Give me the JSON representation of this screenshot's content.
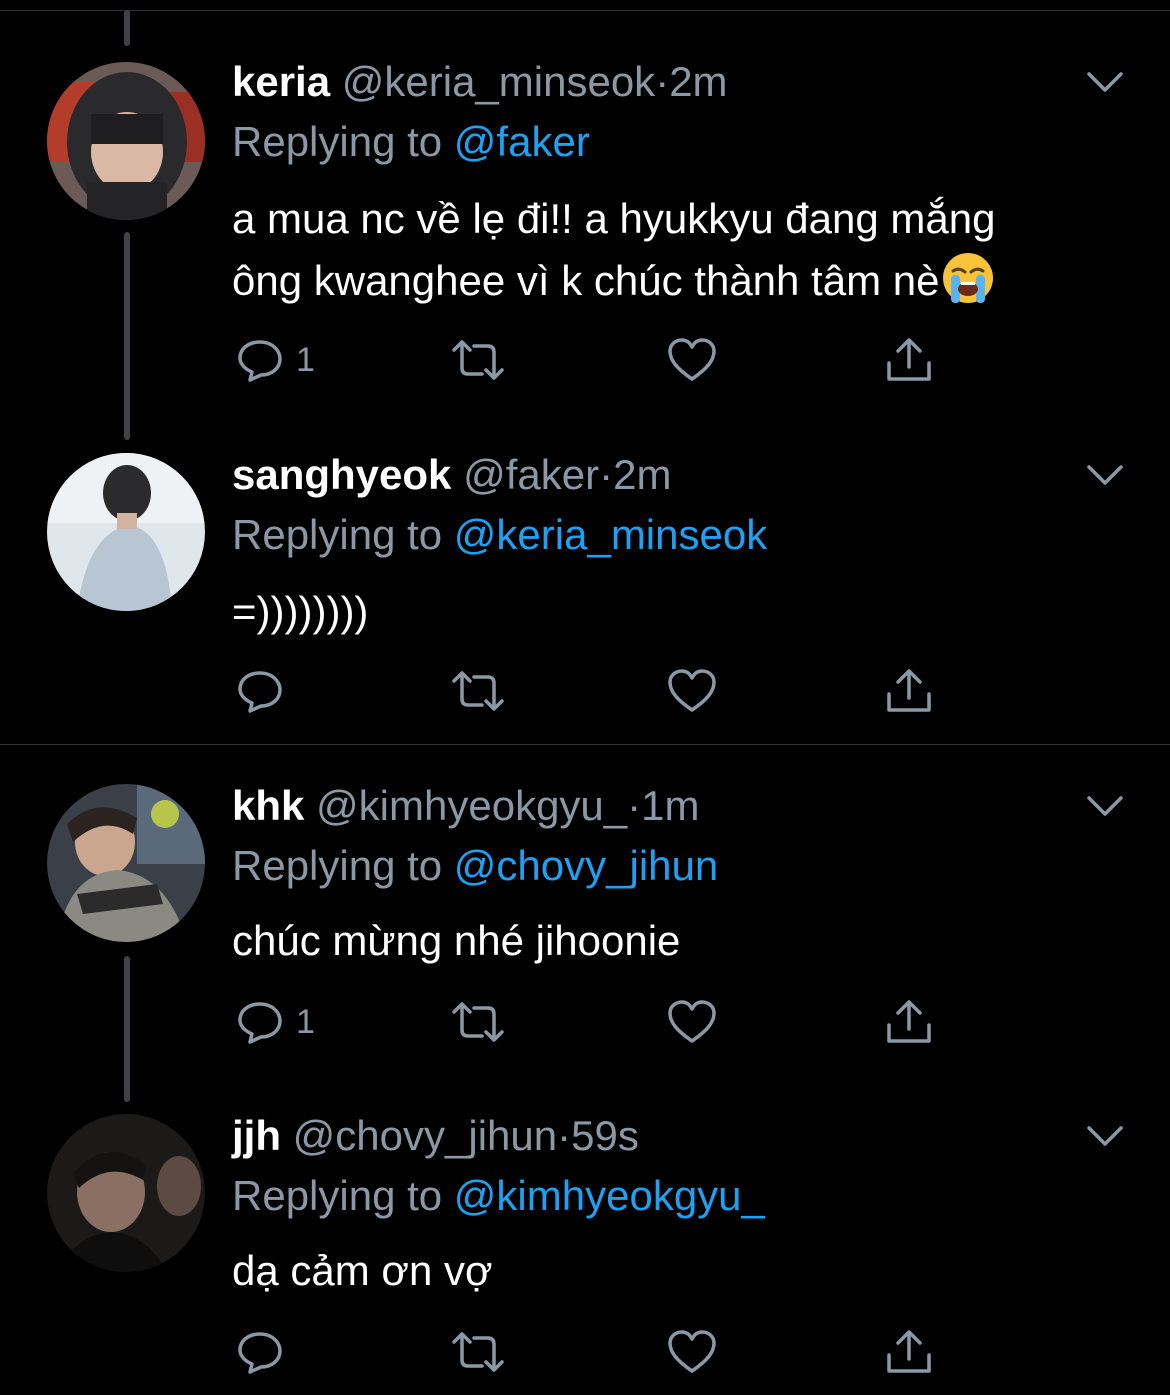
{
  "tweets": [
    {
      "name": "keria",
      "handle": "@keria_minseok",
      "dot": "·",
      "time": "2m",
      "replying_label": "Replying to",
      "replying_to": "@faker",
      "text_lines": [
        "a mua nc về lẹ đi!! a hyukkyu đang mắng",
        "ông kwanghee vì k chúc thành tâm nè"
      ],
      "emoji": "loudly-crying-face",
      "reply_count": "1"
    },
    {
      "name": "sanghyeok",
      "handle": "@faker",
      "dot": "·",
      "time": "2m",
      "replying_label": "Replying to",
      "replying_to": "@keria_minseok",
      "text_lines": [
        "=))))))))"
      ],
      "reply_count": ""
    },
    {
      "name": "khk",
      "handle": "@kimhyeokgyu_",
      "dot": "·",
      "time": "1m",
      "replying_label": "Replying to",
      "replying_to": "@chovy_jihun",
      "text_lines": [
        "chúc mừng nhé jihoonie"
      ],
      "reply_count": "1"
    },
    {
      "name": "jjh",
      "handle": "@chovy_jihun",
      "dot": "·",
      "time": "59s",
      "replying_label": "Replying to",
      "replying_to": "@kimhyeokgyu_",
      "text_lines": [
        "dạ cảm ơn vợ"
      ],
      "reply_count": ""
    }
  ],
  "icons": {
    "reply": "reply-icon",
    "retweet": "retweet-icon",
    "like": "heart-icon",
    "share": "share-icon",
    "more": "chevron-down-icon"
  },
  "colors": {
    "background": "#000000",
    "name": "#ffffff",
    "muted": "#8b98a5",
    "mention": "#1da1f2",
    "separator": "#2f3336"
  }
}
